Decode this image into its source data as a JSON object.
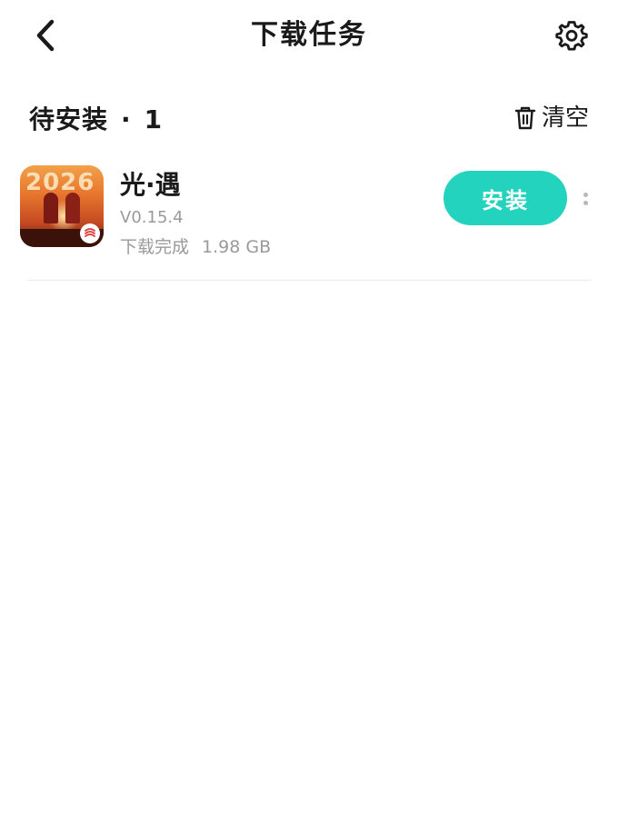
{
  "header": {
    "title": "下载任务",
    "back_icon": "chevron-left-icon",
    "settings_icon": "gear-icon"
  },
  "section": {
    "label": "待安装",
    "separator": "·",
    "count": "1",
    "clear_label": "清空",
    "clear_icon": "trash-icon"
  },
  "downloads": [
    {
      "name": "光·遇",
      "version": "V0.15.4",
      "status": "下载完成",
      "size": "1.98 GB",
      "action_label": "安装",
      "action_color": "#23d3bd"
    }
  ],
  "colors": {
    "accent": "#23d3bd",
    "secondary_text": "#9a9a9a",
    "divider": "#ececec"
  }
}
